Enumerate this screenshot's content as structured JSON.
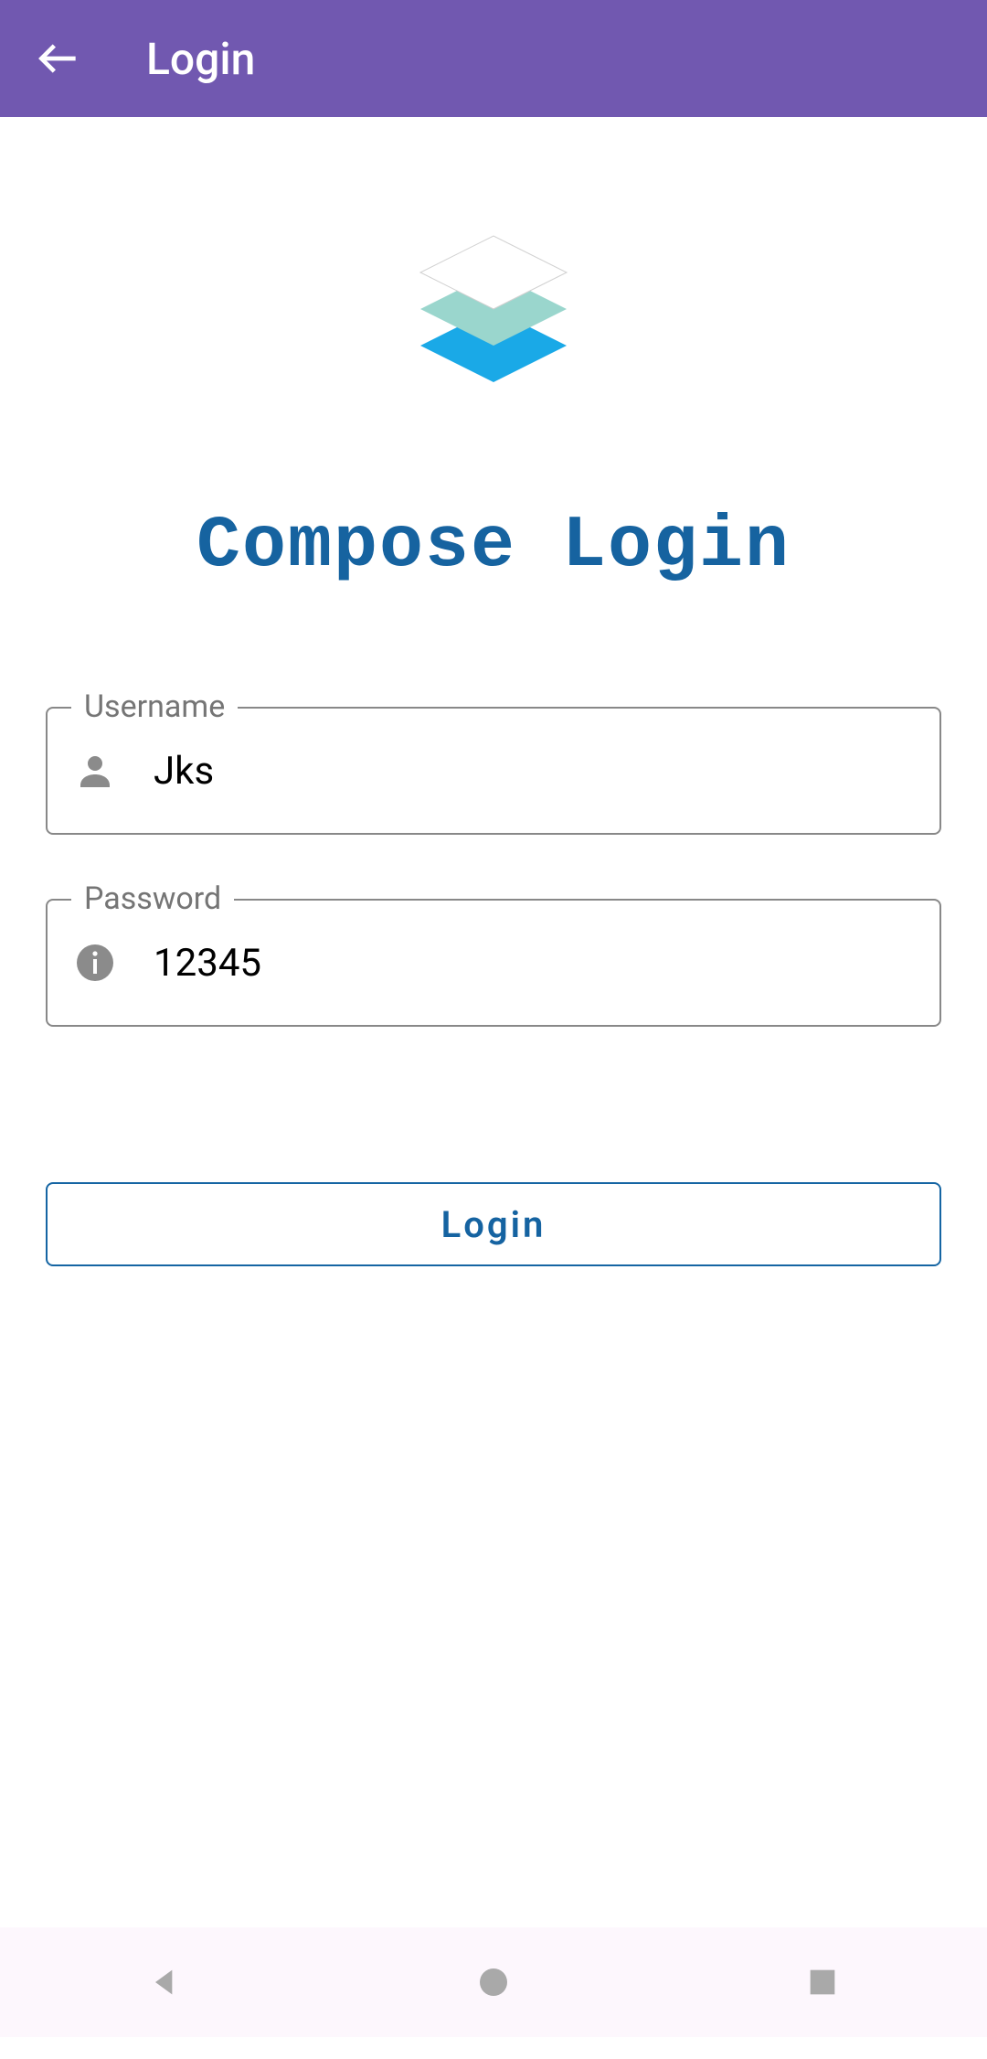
{
  "appbar": {
    "title": "Login"
  },
  "heading": "Compose Login",
  "fields": {
    "username": {
      "label": "Username",
      "value": "Jks"
    },
    "password": {
      "label": "Password",
      "value": "12345"
    }
  },
  "actions": {
    "login": "Login"
  },
  "colors": {
    "appbar": "#7158B0",
    "accent": "#1663A0",
    "logoTop": "#FFFFFF",
    "logoMid": "#9AD6CD",
    "logoBottom": "#1AA9E7"
  }
}
